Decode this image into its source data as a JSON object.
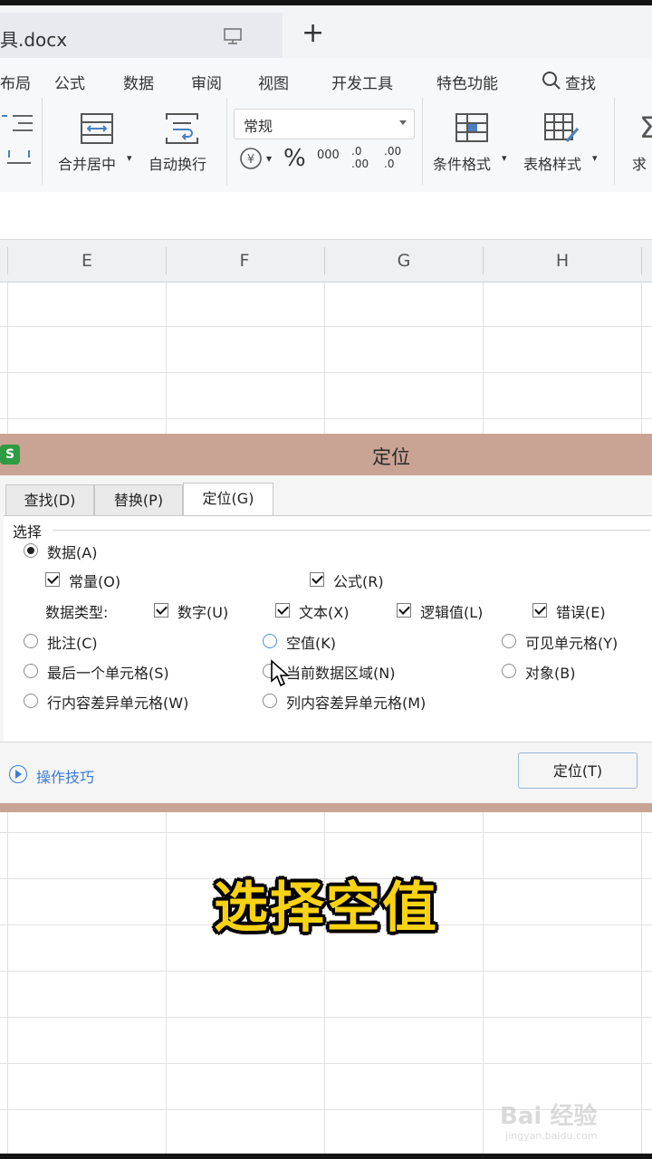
{
  "tab_bar": {
    "doc_title": "具.docx",
    "new_tab": "+"
  },
  "ribbon": {
    "menus": [
      "布局",
      "公式",
      "数据",
      "审阅",
      "视图",
      "开发工具",
      "特色功能",
      "查找"
    ],
    "merge_center": "合并居中",
    "wrap_text": "自动换行",
    "number_format": "常规",
    "percent": "%",
    "thousands": "000",
    "decimal_inc": ".0 .00",
    "decimal_dec": ".00 .0",
    "conditional_format": "条件格式",
    "table_style": "表格样式",
    "sum_partial": "求和"
  },
  "columns": [
    "E",
    "F",
    "G",
    "H"
  ],
  "dialog": {
    "title": "定位",
    "app_badge": "S",
    "tabs": [
      "查找(D)",
      "替换(P)",
      "定位(G)"
    ],
    "active_tab": "定位(G)",
    "group_label": "选择",
    "data_option": "数据(A)",
    "constants": "常量(O)",
    "formulas": "公式(R)",
    "data_type_label": "数据类型:",
    "numbers": "数字(U)",
    "text": "文本(X)",
    "logical": "逻辑值(L)",
    "errors": "错误(E)",
    "comments": "批注(C)",
    "blanks": "空值(K)",
    "visible_cells": "可见单元格(Y)",
    "last_cell": "最后一个单元格(S)",
    "current_region": "当前数据区域(N)",
    "objects": "对象(B)",
    "row_diff": "行内容差异单元格(W)",
    "col_diff": "列内容差异单元格(M)",
    "tips": "操作技巧",
    "locate_button": "定位(T)"
  },
  "caption": "选择空值",
  "watermark": {
    "logo": "Bai 经验",
    "url": "jingyan.baidu.com"
  },
  "colors": {
    "accent": "#3a7bd5",
    "dialog_title": "#c9a393",
    "caption": "#f9d313"
  }
}
